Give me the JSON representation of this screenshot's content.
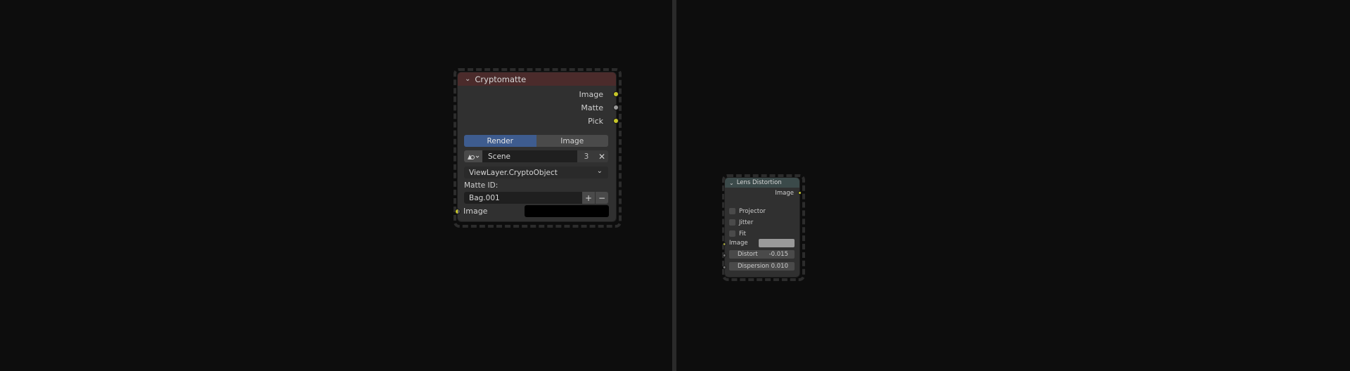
{
  "cryptomatte": {
    "title": "Cryptomatte",
    "header_color": "#4b2b2b",
    "outputs": [
      "Image",
      "Matte",
      "Pick"
    ],
    "source_tabs": {
      "active": "Render",
      "inactive": "Image"
    },
    "scene": {
      "icon": "scene-icon",
      "name": "Scene",
      "users": "3"
    },
    "layer": "ViewLayer.CryptoObject",
    "matte_id_label": "Matte ID:",
    "matte_id_value": "Bag.001",
    "add_symbol": "+",
    "remove_symbol": "−",
    "clear_symbol": "✕",
    "input_label": "Image"
  },
  "lens_distortion": {
    "title": "Lens Distortion",
    "header_color": "#3b4a4a",
    "output": "Image",
    "checkboxes": [
      "Projector",
      "Jitter",
      "Fit"
    ],
    "input_label": "Image",
    "distort": {
      "label": "Distort",
      "value": "-0.015"
    },
    "dispersion": {
      "label": "Dispersion",
      "value": "0.010"
    }
  },
  "colors": {
    "socket_color": "#c7c729",
    "active_tab": "#3e5c8f"
  }
}
